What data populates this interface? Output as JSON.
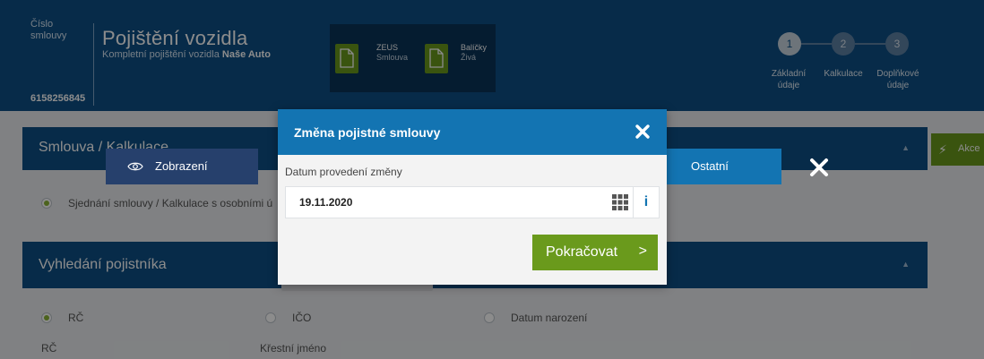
{
  "header": {
    "contract_label": "Číslo smlouvy",
    "contract_number": "6158256845",
    "title": "Pojištění vozidla",
    "subtitle_prefix": "Kompletní pojištění vozidla",
    "subtitle_brand": "Naše Auto",
    "docs": [
      {
        "title": "ZEUS",
        "subtitle": "Smlouva"
      },
      {
        "title": "Balíčky",
        "subtitle": "Živá"
      }
    ],
    "steps": [
      {
        "number": "1",
        "label_line1": "Základní",
        "label_line2": "údaje"
      },
      {
        "number": "2",
        "label_line1": "Kalkulace",
        "label_line2": ""
      },
      {
        "number": "3",
        "label_line1": "Doplňkové",
        "label_line2": "údaje"
      }
    ]
  },
  "background": {
    "panel1_title": "Smlouva / Kalkulace",
    "panel1_option": "Sjednání smlouvy / Kalkulace s osobními ú",
    "panel2_title": "Vyhledání pojistníka",
    "options": [
      "RČ",
      "IČO",
      "Datum narození"
    ],
    "field_labels": [
      "RČ",
      "Křestní jméno"
    ],
    "akce_label": "Akce"
  },
  "tabs": {
    "zobrazeni": "Zobrazení",
    "ostatni": "Ostatní"
  },
  "dialog": {
    "title": "Změna pojistné smlouvy",
    "field_label": "Datum provedení změny",
    "date_value": "19.11.2020",
    "info_label": "i",
    "continue_label": "Pokračovat",
    "continue_chevron": ">"
  },
  "colors": {
    "header_bg": "#0d4f86",
    "dialog_header": "#1374b2",
    "accent_green": "#6a9a1c"
  }
}
